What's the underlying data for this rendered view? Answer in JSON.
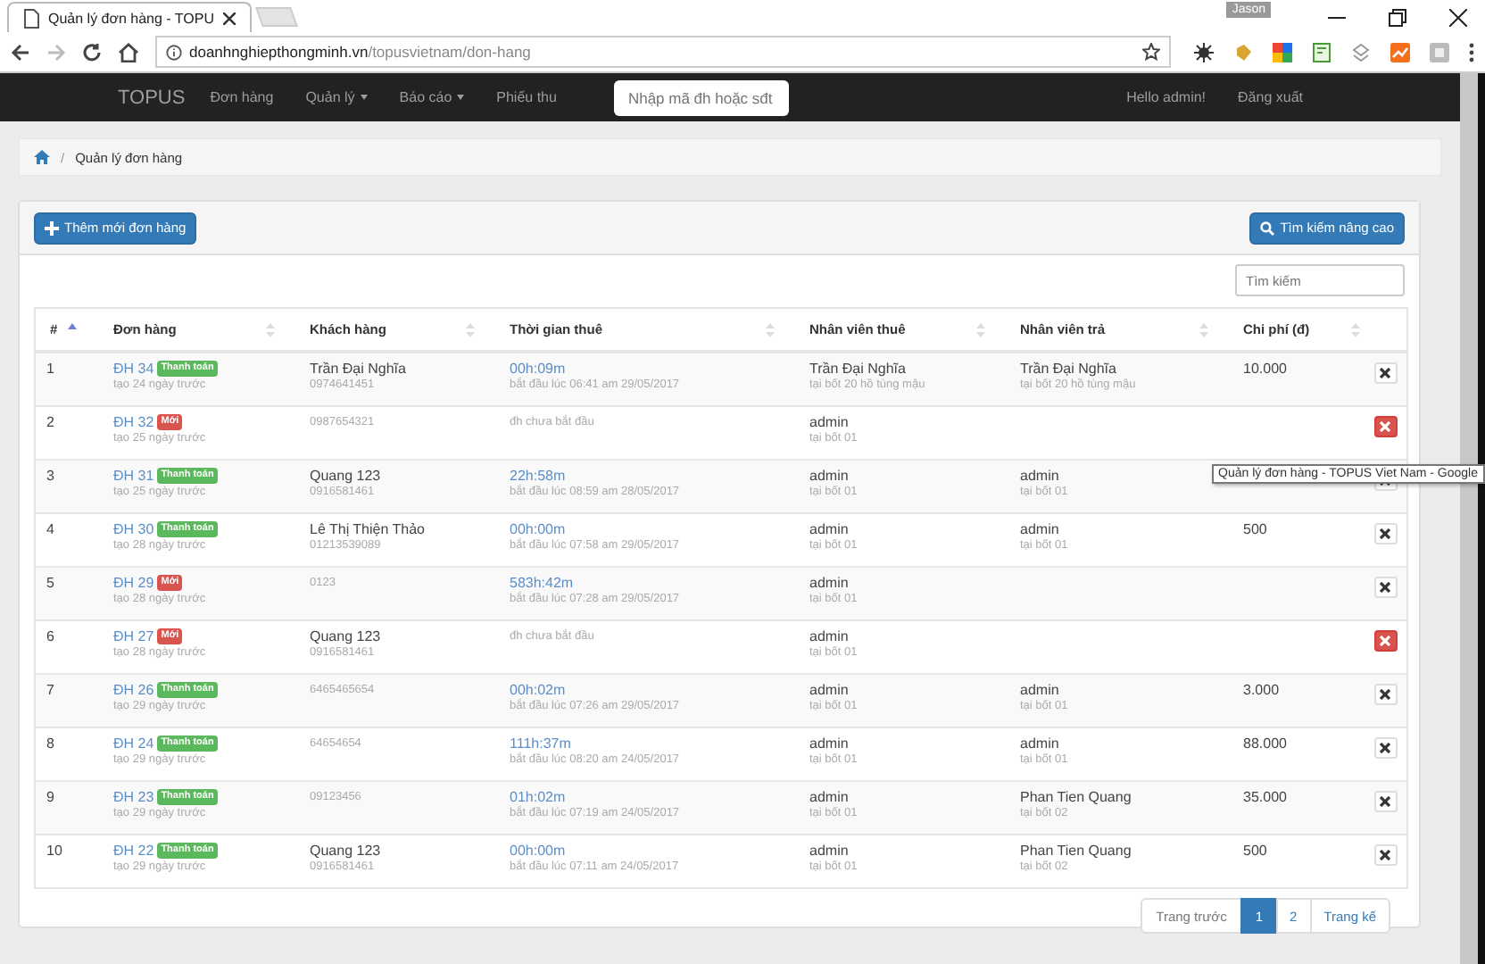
{
  "browser": {
    "tab_title": "Quản lý đơn hàng - TOPU",
    "user": "Jason",
    "url_host": "doanhnghiepthongminh.vn",
    "url_path": "/topusvietnam/don-hang"
  },
  "navbar": {
    "brand": "TOPUS",
    "items": [
      {
        "label": "Đơn hàng",
        "dropdown": false
      },
      {
        "label": "Quản lý",
        "dropdown": true
      },
      {
        "label": "Báo cáo",
        "dropdown": true
      },
      {
        "label": "Phiếu thu",
        "dropdown": false
      }
    ],
    "search": {
      "placeholder": "Nhập mã đh hoặc sđt"
    },
    "greeting": "Hello admin!",
    "logout": "Đăng xuất"
  },
  "breadcrumb": {
    "separator": "/",
    "current": "Quản lý đơn hàng"
  },
  "toolbar": {
    "add_button": "Thêm mới đơn hàng",
    "advanced_search_button": "Tìm kiếm nâng cao"
  },
  "filter": {
    "placeholder": "Tìm kiếm"
  },
  "table": {
    "columns": [
      {
        "label": "#",
        "sorted": true
      },
      {
        "label": "Đơn hàng",
        "sorted": false
      },
      {
        "label": "Khách hàng",
        "sorted": false
      },
      {
        "label": "Thời gian thuê",
        "sorted": false
      },
      {
        "label": "Nhân viên thuê",
        "sorted": false
      },
      {
        "label": "Nhân viên trả",
        "sorted": false
      },
      {
        "label": "Chi phí (đ)",
        "sorted": false
      }
    ],
    "rows": [
      {
        "num": "1",
        "order": "ĐH 34",
        "badge": {
          "text": "Thanh toán",
          "kind": "paid"
        },
        "created": "tạo 24 ngày trước",
        "customer": "Trần Đại Nghĩa",
        "phone": "0974641451",
        "duration": "00h:09m",
        "start": "bắt đầu lúc 06:41 am 29/05/2017",
        "renter": "Trần Đại Nghĩa",
        "renter_place": "tại bốt 20 hồ tùng mậu",
        "returner": "Trần Đại Nghĩa",
        "return_place": "tại bốt 20 hồ tùng mậu",
        "cost": "10.000",
        "danger": false
      },
      {
        "num": "2",
        "order": "ĐH 32",
        "badge": {
          "text": "Mới",
          "kind": "new"
        },
        "created": "tạo 25 ngày trước",
        "phone": "0987654321",
        "start": "đh chưa bắt đầu",
        "renter": "admin",
        "renter_place": "tại bốt 01",
        "danger": true
      },
      {
        "num": "3",
        "order": "ĐH 31",
        "badge": {
          "text": "Thanh toán",
          "kind": "paid"
        },
        "created": "tạo 25 ngày trước",
        "customer": "Quang 123",
        "phone": "0916581461",
        "duration": "22h:58m",
        "start": "bắt đầu lúc 08:59 am 28/05/2017",
        "renter": "admin",
        "renter_place": "tại bốt 01",
        "returner": "admin",
        "return_place": "tại bốt 01",
        "danger": false
      },
      {
        "num": "4",
        "order": "ĐH 30",
        "badge": {
          "text": "Thanh toán",
          "kind": "paid"
        },
        "created": "tạo 28 ngày trước",
        "customer": "Lê Thị Thiện Thảo",
        "phone": "01213539089",
        "duration": "00h:00m",
        "start": "bắt đầu lúc 07:58 am 29/05/2017",
        "renter": "admin",
        "renter_place": "tại bốt 01",
        "returner": "admin",
        "return_place": "tại bốt 01",
        "cost": "500",
        "danger": false
      },
      {
        "num": "5",
        "order": "ĐH 29",
        "badge": {
          "text": "Mới",
          "kind": "new"
        },
        "created": "tạo 28 ngày trước",
        "phone": "0123",
        "duration": "583h:42m",
        "start": "bắt đầu lúc 07:28 am 29/05/2017",
        "renter": "admin",
        "renter_place": "tại bốt 01",
        "danger": false
      },
      {
        "num": "6",
        "order": "ĐH 27",
        "badge": {
          "text": "Mới",
          "kind": "new"
        },
        "created": "tạo 28 ngày trước",
        "customer": "Quang 123",
        "phone": "0916581461",
        "start": "đh chưa bắt đầu",
        "renter": "admin",
        "renter_place": "tại bốt 01",
        "danger": true
      },
      {
        "num": "7",
        "order": "ĐH 26",
        "badge": {
          "text": "Thanh toán",
          "kind": "paid"
        },
        "created": "tạo 29 ngày trước",
        "phone": "6465465654",
        "duration": "00h:02m",
        "start": "bắt đầu lúc 07:26 am 29/05/2017",
        "renter": "admin",
        "renter_place": "tại bốt 01",
        "returner": "admin",
        "return_place": "tại bốt 01",
        "cost": "3.000",
        "danger": false
      },
      {
        "num": "8",
        "order": "ĐH 24",
        "badge": {
          "text": "Thanh toán",
          "kind": "paid"
        },
        "created": "tạo 29 ngày trước",
        "phone": "64654654",
        "duration": "111h:37m",
        "start": "bắt đầu lúc 08:20 am 24/05/2017",
        "renter": "admin",
        "renter_place": "tại bốt 01",
        "returner": "admin",
        "return_place": "tại bốt 01",
        "cost": "88.000",
        "danger": false
      },
      {
        "num": "9",
        "order": "ĐH 23",
        "badge": {
          "text": "Thanh toán",
          "kind": "paid"
        },
        "created": "tạo 29 ngày trước",
        "phone": "09123456",
        "duration": "01h:02m",
        "start": "bắt đầu lúc 07:19 am 24/05/2017",
        "renter": "admin",
        "renter_place": "tại bốt 01",
        "returner": "Phan Tien Quang",
        "return_place": "tại bốt 02",
        "cost": "35.000",
        "danger": false
      },
      {
        "num": "10",
        "order": "ĐH 22",
        "badge": {
          "text": "Thanh toán",
          "kind": "paid"
        },
        "created": "tạo 29 ngày trước",
        "customer": "Quang 123",
        "phone": "0916581461",
        "duration": "00h:00m",
        "start": "bắt đầu lúc 07:11 am 24/05/2017",
        "renter": "admin",
        "renter_place": "tại bốt 01",
        "returner": "Phan Tien Quang",
        "return_place": "tại bốt 02",
        "cost": "500",
        "danger": false
      }
    ]
  },
  "pagination": [
    {
      "label": "Trang trước",
      "selected": false
    },
    {
      "label": "1",
      "selected": true
    },
    {
      "label": "2",
      "selected": false
    },
    {
      "label": "Trang kế",
      "selected": false
    }
  ],
  "tooltip": "Quản lý đơn hàng - TOPUS Viet Nam - Google"
}
